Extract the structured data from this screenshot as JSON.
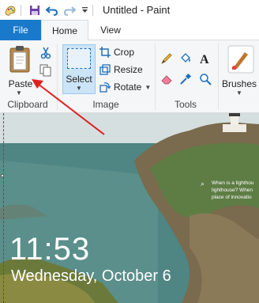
{
  "titlebar": {
    "title": "Untitled - Paint",
    "separator": "|"
  },
  "tabs": [
    {
      "label": "File"
    },
    {
      "label": "Home"
    },
    {
      "label": "View"
    }
  ],
  "clipboard": {
    "paste_label": "Paste",
    "group_label": "Clipboard"
  },
  "image": {
    "select_label": "Select",
    "crop_label": "Crop",
    "resize_label": "Resize",
    "rotate_label": "Rotate",
    "group_label": "Image"
  },
  "tools": {
    "group_label": "Tools"
  },
  "brushes": {
    "label": "Brushes"
  },
  "lockscreen": {
    "time": "11:53",
    "date": "Wednesday, October 6",
    "spotlight_lines": [
      "When is a lighthou",
      "lighthouse? When",
      "place of innovatio"
    ]
  },
  "colors": {
    "file_tab": "#1979ca",
    "ribbon_bg": "#f5f6f7",
    "select_active": "#cce4f7",
    "annotation_arrow": "#e02020"
  }
}
